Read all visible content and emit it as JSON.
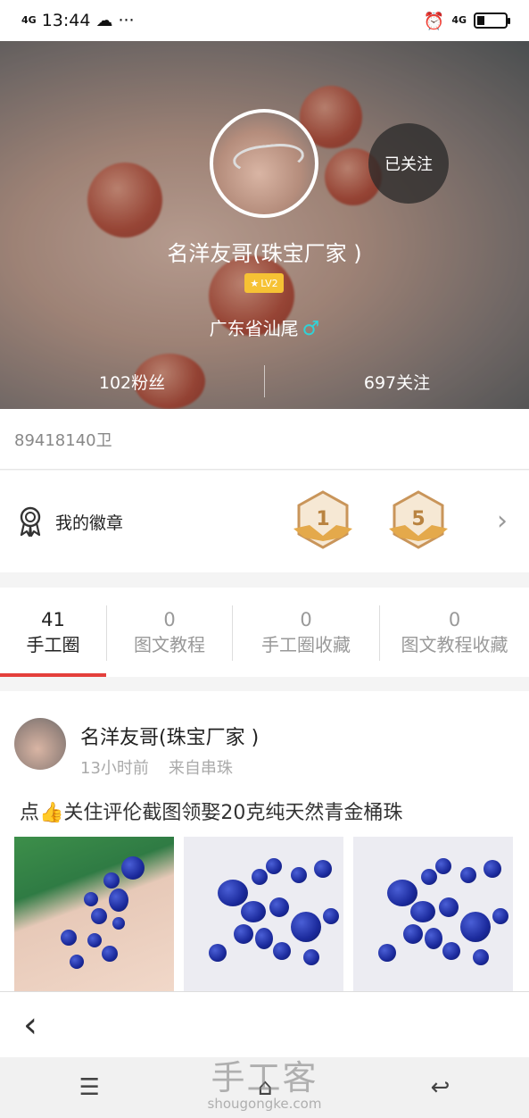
{
  "status_bar": {
    "network": "4G",
    "time": "13:44",
    "more": "···",
    "network_right": "4G"
  },
  "profile": {
    "name": "名洋友哥(珠宝厂家 )",
    "follow_button": "已关注",
    "level": "LV2",
    "location": "广东省汕尾",
    "gender_symbol": "♂",
    "fans": "102粉丝",
    "following": "697关注",
    "id": "89418140卫"
  },
  "badges": {
    "label": "我的徽章",
    "items": [
      "1",
      "5"
    ]
  },
  "tabs": [
    {
      "count": "41",
      "label": "手工圈"
    },
    {
      "count": "0",
      "label": "图文教程"
    },
    {
      "count": "0",
      "label": "手工圈收藏"
    },
    {
      "count": "0",
      "label": "图文教程收藏"
    }
  ],
  "post": {
    "author": "名洋友哥(珠宝厂家 )",
    "time": "13小时前",
    "source": "来自串珠",
    "text": "点👍关住评伦截图领娶20克纯天然青金桶珠"
  },
  "nav": {
    "back": "‹"
  },
  "watermark": {
    "brand": "手工客",
    "url": "shougongke.com"
  },
  "colors": {
    "accent": "#e43f3b",
    "gender": "#2fd3d8",
    "level_badge": "#f6c234"
  }
}
